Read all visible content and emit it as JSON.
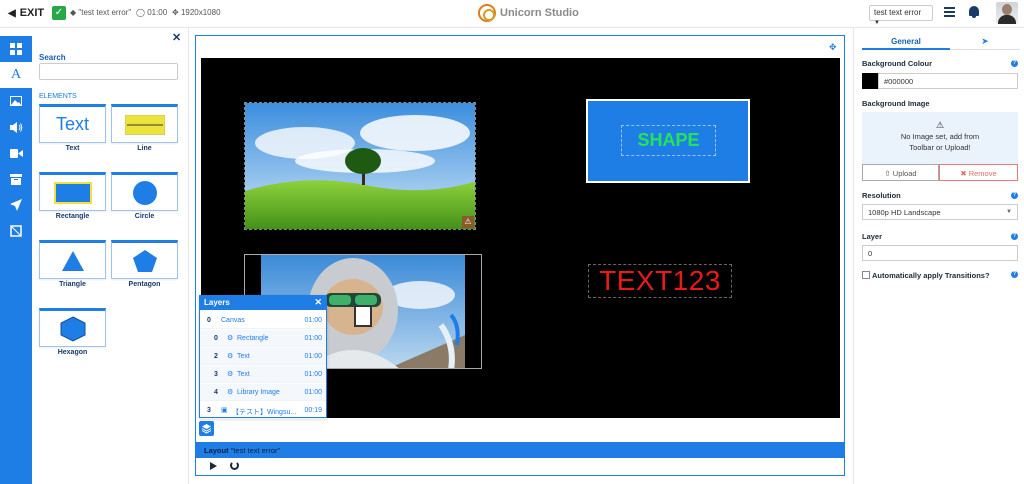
{
  "topbar": {
    "exit_label": "EXIT",
    "layout_name": "\"test text error\"",
    "duration": "01:00",
    "resolution": "1920x1080",
    "brand": "Unicorn Studio",
    "layout_selector": "test text error"
  },
  "rail": {
    "items": [
      "layout-icon",
      "text-icon",
      "image-icon",
      "audio-icon",
      "video-icon",
      "library-icon",
      "send-icon",
      "crop-icon"
    ],
    "active": "text-icon"
  },
  "toolbox": {
    "search_label": "Search",
    "search_placeholder": "",
    "elements_label": "ELEMENTS",
    "elements": [
      {
        "label": "Text",
        "preview": "Text"
      },
      {
        "label": "Line"
      },
      {
        "label": "Rectangle"
      },
      {
        "label": "Circle"
      },
      {
        "label": "Triangle"
      },
      {
        "label": "Pentagon"
      },
      {
        "label": "Hexagon"
      }
    ]
  },
  "canvas": {
    "background": "#000000",
    "shape_text": "SHAPE",
    "text_element": "TEXT123"
  },
  "layers": {
    "title": "Layers",
    "rows": [
      {
        "num": "0",
        "name": "Canvas",
        "duration": "01:00"
      },
      {
        "num": "0",
        "name": "Rectangle",
        "duration": "01:00"
      },
      {
        "num": "2",
        "name": "Text",
        "duration": "01:00"
      },
      {
        "num": "3",
        "name": "Text",
        "duration": "01:00"
      },
      {
        "num": "4",
        "name": "Library Image",
        "duration": "01:00"
      },
      {
        "num": "3",
        "name": "【テスト】Wingsu...",
        "duration": "00:19"
      }
    ]
  },
  "layout_bar": {
    "prefix": "Layout",
    "name": "\"test text error\""
  },
  "properties": {
    "tab_general": "General",
    "bg_colour_label": "Background Colour",
    "bg_colour_value": "#000000",
    "bg_image_label": "Background Image",
    "bg_image_message_line1": "No Image set, add from",
    "bg_image_message_line2": "Toolbar or Upload!",
    "upload_label": "Upload",
    "remove_label": "Remove",
    "resolution_label": "Resolution",
    "resolution_value": "1080p HD Landscape",
    "layer_label": "Layer",
    "layer_value": "0",
    "transitions_label": "Automatically apply Transitions?",
    "help_glyph": "?"
  },
  "colors": {
    "accent": "#1f7de6",
    "shape_fill": "#1f7de6",
    "shape_text": "#22e45a",
    "text_element": "#e81a1a",
    "remove": "#e36b6b"
  }
}
